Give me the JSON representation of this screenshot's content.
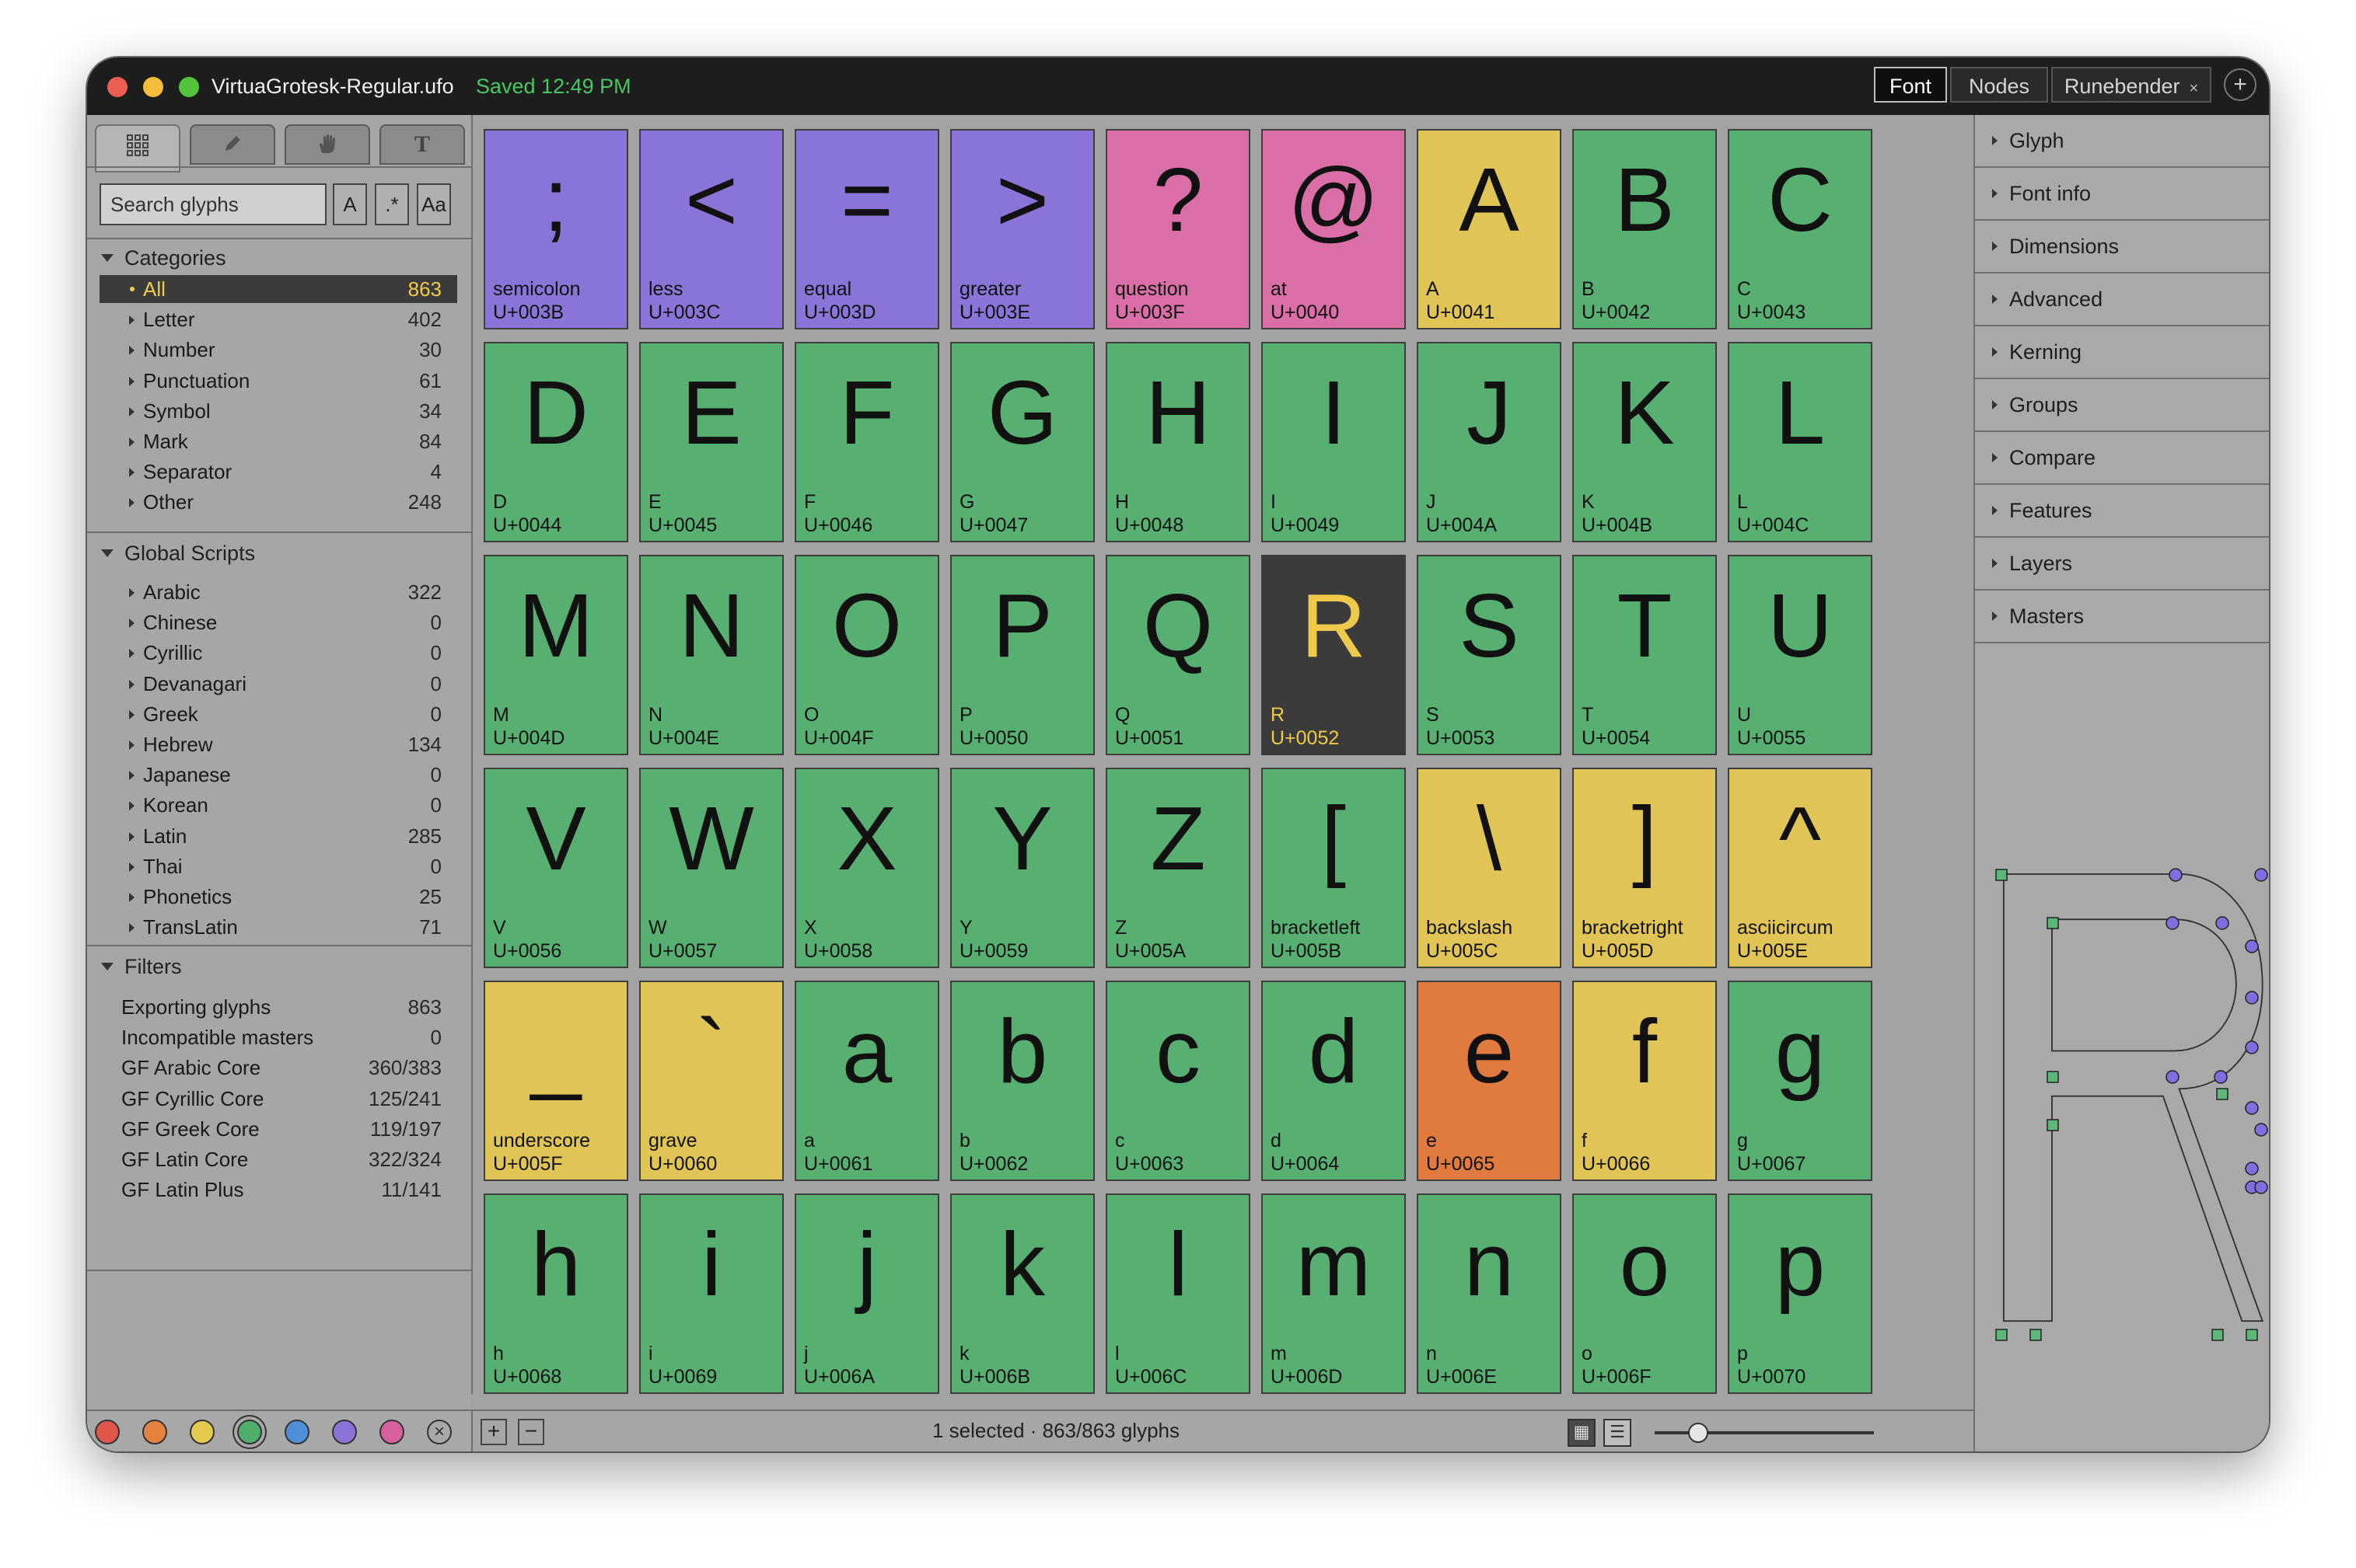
{
  "window": {
    "title": "VirtuaGrotesk-Regular.ufo",
    "saved": "Saved 12:49 PM",
    "tabs": [
      {
        "label": "Font",
        "active": true
      },
      {
        "label": "Nodes",
        "active": false
      },
      {
        "label": "Runebender",
        "active": false,
        "closable": true
      }
    ],
    "new_tab_icon": "plus-icon",
    "traffic_lights": [
      "#ee5d53",
      "#f4bd3a",
      "#52c43c"
    ]
  },
  "sidebar": {
    "tools": [
      "grid-icon",
      "pencil-icon",
      "hand-icon",
      "text-tool-icon"
    ],
    "search": {
      "placeholder": "Search glyphs",
      "opt_case": "A",
      "opt_regex": ".*",
      "opt_match": "Aa"
    },
    "categories": {
      "title": "Categories",
      "items": [
        {
          "label": "All",
          "count": "863",
          "selected": true
        },
        {
          "label": "Letter",
          "count": "402"
        },
        {
          "label": "Number",
          "count": "30"
        },
        {
          "label": "Punctuation",
          "count": "61"
        },
        {
          "label": "Symbol",
          "count": "34"
        },
        {
          "label": "Mark",
          "count": "84"
        },
        {
          "label": "Separator",
          "count": "4"
        },
        {
          "label": "Other",
          "count": "248"
        }
      ]
    },
    "scripts": {
      "title": "Global Scripts",
      "items": [
        {
          "label": "Arabic",
          "count": "322"
        },
        {
          "label": "Chinese",
          "count": "0"
        },
        {
          "label": "Cyrillic",
          "count": "0"
        },
        {
          "label": "Devanagari",
          "count": "0"
        },
        {
          "label": "Greek",
          "count": "0"
        },
        {
          "label": "Hebrew",
          "count": "134"
        },
        {
          "label": "Japanese",
          "count": "0"
        },
        {
          "label": "Korean",
          "count": "0"
        },
        {
          "label": "Latin",
          "count": "285"
        },
        {
          "label": "Thai",
          "count": "0"
        },
        {
          "label": "Phonetics",
          "count": "25"
        },
        {
          "label": "TransLatin",
          "count": "71"
        }
      ]
    },
    "filters": {
      "title": "Filters",
      "items": [
        {
          "label": "Exporting glyphs",
          "count": "863"
        },
        {
          "label": "Incompatible masters",
          "count": "0"
        },
        {
          "label": "GF Arabic Core",
          "count": "360/383"
        },
        {
          "label": "GF Cyrillic Core",
          "count": "125/241"
        },
        {
          "label": "GF Greek Core",
          "count": "119/197"
        },
        {
          "label": "GF Latin Core",
          "count": "322/324"
        },
        {
          "label": "GF Latin Plus",
          "count": "11/141"
        }
      ]
    },
    "color_swatches": [
      "#e0564a",
      "#e7813f",
      "#e4c94f",
      "#4fae6b",
      "#4e8fd8",
      "#8b72d6",
      "#d9609f"
    ],
    "selected_swatch": 3,
    "clear_swatch_icon": "clear-x-icon"
  },
  "glyphs": [
    {
      "char": ";",
      "name": "semicolon",
      "code": "U+003B",
      "color": "purple"
    },
    {
      "char": "<",
      "name": "less",
      "code": "U+003C",
      "color": "purple"
    },
    {
      "char": "=",
      "name": "equal",
      "code": "U+003D",
      "color": "purple"
    },
    {
      "char": ">",
      "name": "greater",
      "code": "U+003E",
      "color": "purple"
    },
    {
      "char": "?",
      "name": "question",
      "code": "U+003F",
      "color": "pink"
    },
    {
      "char": "@",
      "name": "at",
      "code": "U+0040",
      "color": "pink"
    },
    {
      "char": "A",
      "name": "A",
      "code": "U+0041",
      "color": "yellow"
    },
    {
      "char": "B",
      "name": "B",
      "code": "U+0042",
      "color": "green"
    },
    {
      "char": "C",
      "name": "C",
      "code": "U+0043",
      "color": "green"
    },
    {
      "char": "D",
      "name": "D",
      "code": "U+0044",
      "color": "green"
    },
    {
      "char": "E",
      "name": "E",
      "code": "U+0045",
      "color": "green"
    },
    {
      "char": "F",
      "name": "F",
      "code": "U+0046",
      "color": "green"
    },
    {
      "char": "G",
      "name": "G",
      "code": "U+0047",
      "color": "green"
    },
    {
      "char": "H",
      "name": "H",
      "code": "U+0048",
      "color": "green"
    },
    {
      "char": "I",
      "name": "I",
      "code": "U+0049",
      "color": "green"
    },
    {
      "char": "J",
      "name": "J",
      "code": "U+004A",
      "color": "green"
    },
    {
      "char": "K",
      "name": "K",
      "code": "U+004B",
      "color": "green"
    },
    {
      "char": "L",
      "name": "L",
      "code": "U+004C",
      "color": "green"
    },
    {
      "char": "M",
      "name": "M",
      "code": "U+004D",
      "color": "green"
    },
    {
      "char": "N",
      "name": "N",
      "code": "U+004E",
      "color": "green"
    },
    {
      "char": "O",
      "name": "O",
      "code": "U+004F",
      "color": "green"
    },
    {
      "char": "P",
      "name": "P",
      "code": "U+0050",
      "color": "green"
    },
    {
      "char": "Q",
      "name": "Q",
      "code": "U+0051",
      "color": "green"
    },
    {
      "char": "R",
      "name": "R",
      "code": "U+0052",
      "color": "selected"
    },
    {
      "char": "S",
      "name": "S",
      "code": "U+0053",
      "color": "green"
    },
    {
      "char": "T",
      "name": "T",
      "code": "U+0054",
      "color": "green"
    },
    {
      "char": "U",
      "name": "U",
      "code": "U+0055",
      "color": "green"
    },
    {
      "char": "V",
      "name": "V",
      "code": "U+0056",
      "color": "green"
    },
    {
      "char": "W",
      "name": "W",
      "code": "U+0057",
      "color": "green"
    },
    {
      "char": "X",
      "name": "X",
      "code": "U+0058",
      "color": "green"
    },
    {
      "char": "Y",
      "name": "Y",
      "code": "U+0059",
      "color": "green"
    },
    {
      "char": "Z",
      "name": "Z",
      "code": "U+005A",
      "color": "green"
    },
    {
      "char": "[",
      "name": "bracketleft",
      "code": "U+005B",
      "color": "green"
    },
    {
      "char": "\\",
      "name": "backslash",
      "code": "U+005C",
      "color": "yellow"
    },
    {
      "char": "]",
      "name": "bracketright",
      "code": "U+005D",
      "color": "yellow"
    },
    {
      "char": "^",
      "name": "asciicircum",
      "code": "U+005E",
      "color": "yellow"
    },
    {
      "char": "_",
      "name": "underscore",
      "code": "U+005F",
      "color": "yellow"
    },
    {
      "char": "`",
      "name": "grave",
      "code": "U+0060",
      "color": "yellow"
    },
    {
      "char": "a",
      "name": "a",
      "code": "U+0061",
      "color": "green"
    },
    {
      "char": "b",
      "name": "b",
      "code": "U+0062",
      "color": "green"
    },
    {
      "char": "c",
      "name": "c",
      "code": "U+0063",
      "color": "green"
    },
    {
      "char": "d",
      "name": "d",
      "code": "U+0064",
      "color": "green"
    },
    {
      "char": "e",
      "name": "e",
      "code": "U+0065",
      "color": "orange"
    },
    {
      "char": "f",
      "name": "f",
      "code": "U+0066",
      "color": "yellow"
    },
    {
      "char": "g",
      "name": "g",
      "code": "U+0067",
      "color": "green"
    },
    {
      "char": "h",
      "name": "h",
      "code": "U+0068",
      "color": "green"
    },
    {
      "char": "i",
      "name": "i",
      "code": "U+0069",
      "color": "green"
    },
    {
      "char": "j",
      "name": "j",
      "code": "U+006A",
      "color": "green"
    },
    {
      "char": "k",
      "name": "k",
      "code": "U+006B",
      "color": "green"
    },
    {
      "char": "l",
      "name": "l",
      "code": "U+006C",
      "color": "green"
    },
    {
      "char": "m",
      "name": "m",
      "code": "U+006D",
      "color": "green"
    },
    {
      "char": "n",
      "name": "n",
      "code": "U+006E",
      "color": "green"
    },
    {
      "char": "o",
      "name": "o",
      "code": "U+006F",
      "color": "green"
    },
    {
      "char": "p",
      "name": "p",
      "code": "U+0070",
      "color": "green"
    }
  ],
  "statusbar": {
    "add_label": "+",
    "remove_label": "−",
    "text": "1 selected · 863/863 glyphs",
    "view_grid_icon": "grid-view-icon",
    "view_list_icon": "list-view-icon",
    "zoom_level": 0.2
  },
  "inspector": {
    "sections": [
      "Glyph",
      "Font info",
      "Dimensions",
      "Advanced",
      "Kerning",
      "Groups",
      "Compare",
      "Features",
      "Layers",
      "Masters"
    ],
    "preview_glyph": "R"
  }
}
